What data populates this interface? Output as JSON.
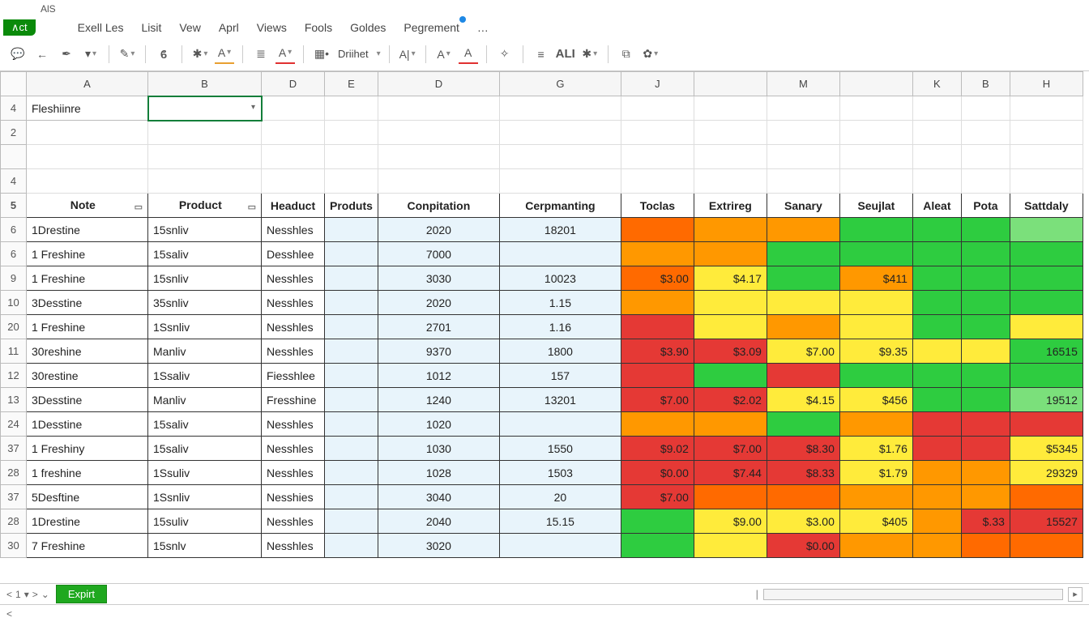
{
  "title": "AlS",
  "app_badge": "∧ct",
  "menu": [
    "Exell Les",
    "Lisit",
    "Vew",
    "Aprl",
    "Views",
    "Fools",
    "Goldes",
    "Pegrement",
    "…"
  ],
  "menu_dot_index": 7,
  "toolbar": {
    "dlabel": "Driihet",
    "alt": "ALI"
  },
  "columns": [
    "A",
    "B",
    "D",
    "E",
    "D",
    "G",
    "J",
    "",
    "M",
    "",
    "K",
    "B",
    "H"
  ],
  "name_box": "Fleshiinre",
  "row_heads": [
    "4",
    "2",
    "",
    "4",
    "5",
    "6",
    "6",
    "9",
    "10",
    "20",
    "11",
    "12",
    "13",
    "24",
    "37",
    "28",
    "37",
    "28",
    "30"
  ],
  "header": [
    "Note",
    "Product",
    "Headuct",
    "Produts",
    "Conpitation",
    "Cerpmanting",
    "Toclas",
    "Extrireg",
    "Sanary",
    "Seujlat",
    "Aleat",
    "Pota",
    "Sattdaly"
  ],
  "rows": [
    {
      "a": "1Drestine",
      "b": "15snliv",
      "d1": "Nesshles",
      "d2": "2020",
      "g": "18201",
      "cells": [
        {
          "c": "o1"
        },
        {
          "c": "o2"
        },
        {
          "c": "o2"
        },
        {
          "c": "g"
        },
        {
          "c": "g"
        },
        {
          "c": "g"
        },
        {
          "c": "g2"
        }
      ]
    },
    {
      "a": "1 Freshine",
      "b": "15saliv",
      "d1": "Desshlee",
      "d2": "7000",
      "g": "",
      "cells": [
        {
          "c": "o2"
        },
        {
          "c": "o2"
        },
        {
          "c": "g"
        },
        {
          "c": "g"
        },
        {
          "c": "g"
        },
        {
          "c": "g"
        },
        {
          "c": "g"
        }
      ]
    },
    {
      "a": "1 Freshine",
      "b": "15snliv",
      "d1": "Nesshles",
      "d2": "3030",
      "g": "10023",
      "cells": [
        {
          "c": "o1",
          "v": "$3.00"
        },
        {
          "c": "y",
          "v": "$4.17"
        },
        {
          "c": "g"
        },
        {
          "c": "o2",
          "v": "$411"
        },
        {
          "c": "g"
        },
        {
          "c": "g"
        },
        {
          "c": "g"
        }
      ]
    },
    {
      "a": "3Desstine",
      "b": "35snliv",
      "d1": "Nesshles",
      "d2": "2020",
      "g": "1.15",
      "cells": [
        {
          "c": "o2"
        },
        {
          "c": "y"
        },
        {
          "c": "y"
        },
        {
          "c": "y"
        },
        {
          "c": "g"
        },
        {
          "c": "g"
        },
        {
          "c": "g"
        }
      ]
    },
    {
      "a": "1 Freshine",
      "b": "1Ssnliv",
      "d1": "Nesshles",
      "d2": "2701",
      "g": "1.16",
      "cells": [
        {
          "c": "r"
        },
        {
          "c": "y"
        },
        {
          "c": "o2"
        },
        {
          "c": "y"
        },
        {
          "c": "g"
        },
        {
          "c": "g"
        },
        {
          "c": "y"
        }
      ]
    },
    {
      "a": "30reshine",
      "b": "Manliv",
      "d1": "Nesshles",
      "d2": "9370",
      "g": "1800",
      "cells": [
        {
          "c": "r",
          "v": "$3.90"
        },
        {
          "c": "r",
          "v": "$3.09"
        },
        {
          "c": "y",
          "v": "$7.00"
        },
        {
          "c": "y",
          "v": "$9.35"
        },
        {
          "c": "y"
        },
        {
          "c": "y"
        },
        {
          "c": "g",
          "v": "16515"
        }
      ]
    },
    {
      "a": "30restine",
      "b": "1Ssaliv",
      "d1": "Fiesshlee",
      "d2": "1012",
      "g": "157",
      "cells": [
        {
          "c": "r"
        },
        {
          "c": "g"
        },
        {
          "c": "r"
        },
        {
          "c": "g"
        },
        {
          "c": "g"
        },
        {
          "c": "g"
        },
        {
          "c": "g"
        }
      ]
    },
    {
      "a": "3Desstine",
      "b": "Manliv",
      "d1": "Fresshine",
      "d2": "1240",
      "g": "13201",
      "cells": [
        {
          "c": "r",
          "v": "$7.00"
        },
        {
          "c": "r",
          "v": "$2.02"
        },
        {
          "c": "y",
          "v": "$4.15"
        },
        {
          "c": "y",
          "v": "$456"
        },
        {
          "c": "g"
        },
        {
          "c": "g"
        },
        {
          "c": "g2",
          "v": "19512"
        }
      ]
    },
    {
      "a": "1Desstine",
      "b": "15saliv",
      "d1": "Nesshles",
      "d2": "1020",
      "g": "",
      "cells": [
        {
          "c": "o2"
        },
        {
          "c": "o2"
        },
        {
          "c": "g"
        },
        {
          "c": "o2"
        },
        {
          "c": "r"
        },
        {
          "c": "r"
        },
        {
          "c": "r"
        }
      ]
    },
    {
      "a": "1 Freshiny",
      "b": "15saliv",
      "d1": "Nesshles",
      "d2": "1030",
      "g": "1550",
      "cells": [
        {
          "c": "r",
          "v": "$9.02"
        },
        {
          "c": "r",
          "v": "$7.00"
        },
        {
          "c": "r",
          "v": "$8.30"
        },
        {
          "c": "y",
          "v": "$1.76"
        },
        {
          "c": "r"
        },
        {
          "c": "r"
        },
        {
          "c": "y",
          "v": "$5345"
        }
      ]
    },
    {
      "a": "1 freshine",
      "b": "1Ssuliv",
      "d1": "Nesshles",
      "d2": "1028",
      "g": "1503",
      "cells": [
        {
          "c": "r",
          "v": "$0.00"
        },
        {
          "c": "r",
          "v": "$7.44"
        },
        {
          "c": "r",
          "v": "$8.33"
        },
        {
          "c": "y",
          "v": "$1.79"
        },
        {
          "c": "o2"
        },
        {
          "c": "o2"
        },
        {
          "c": "y",
          "v": "29329"
        }
      ]
    },
    {
      "a": "5Desftine",
      "b": "1Ssnliv",
      "d1": "Nesshies",
      "d2": "3040",
      "g": "20",
      "cells": [
        {
          "c": "r",
          "v": "$7.00"
        },
        {
          "c": "o1"
        },
        {
          "c": "o1"
        },
        {
          "c": "o2"
        },
        {
          "c": "o2"
        },
        {
          "c": "o2"
        },
        {
          "c": "o1"
        }
      ]
    },
    {
      "a": "1Drestine",
      "b": "15suliv",
      "d1": "Nesshles",
      "d2": "2040",
      "g": "15.15",
      "cells": [
        {
          "c": "g"
        },
        {
          "c": "y",
          "v": "$9.00"
        },
        {
          "c": "y",
          "v": "$3.00"
        },
        {
          "c": "y",
          "v": "$405"
        },
        {
          "c": "o2"
        },
        {
          "c": "r",
          "v": "$.33"
        },
        {
          "c": "r",
          "v": "15527"
        }
      ]
    },
    {
      "a": "7 Freshine",
      "b": "15snlv",
      "d1": "Nesshles",
      "d2": "3020",
      "g": "",
      "cells": [
        {
          "c": "g"
        },
        {
          "c": "y"
        },
        {
          "c": "r",
          "v": "$0.00"
        },
        {
          "c": "o2"
        },
        {
          "c": "o2"
        },
        {
          "c": "o1"
        },
        {
          "c": "o1"
        }
      ]
    }
  ],
  "sheet_tab": "Expirt",
  "nav": {
    "first": "<",
    "one": "1",
    "drop": "▾",
    "sep": ">",
    "caret": "⌄"
  }
}
